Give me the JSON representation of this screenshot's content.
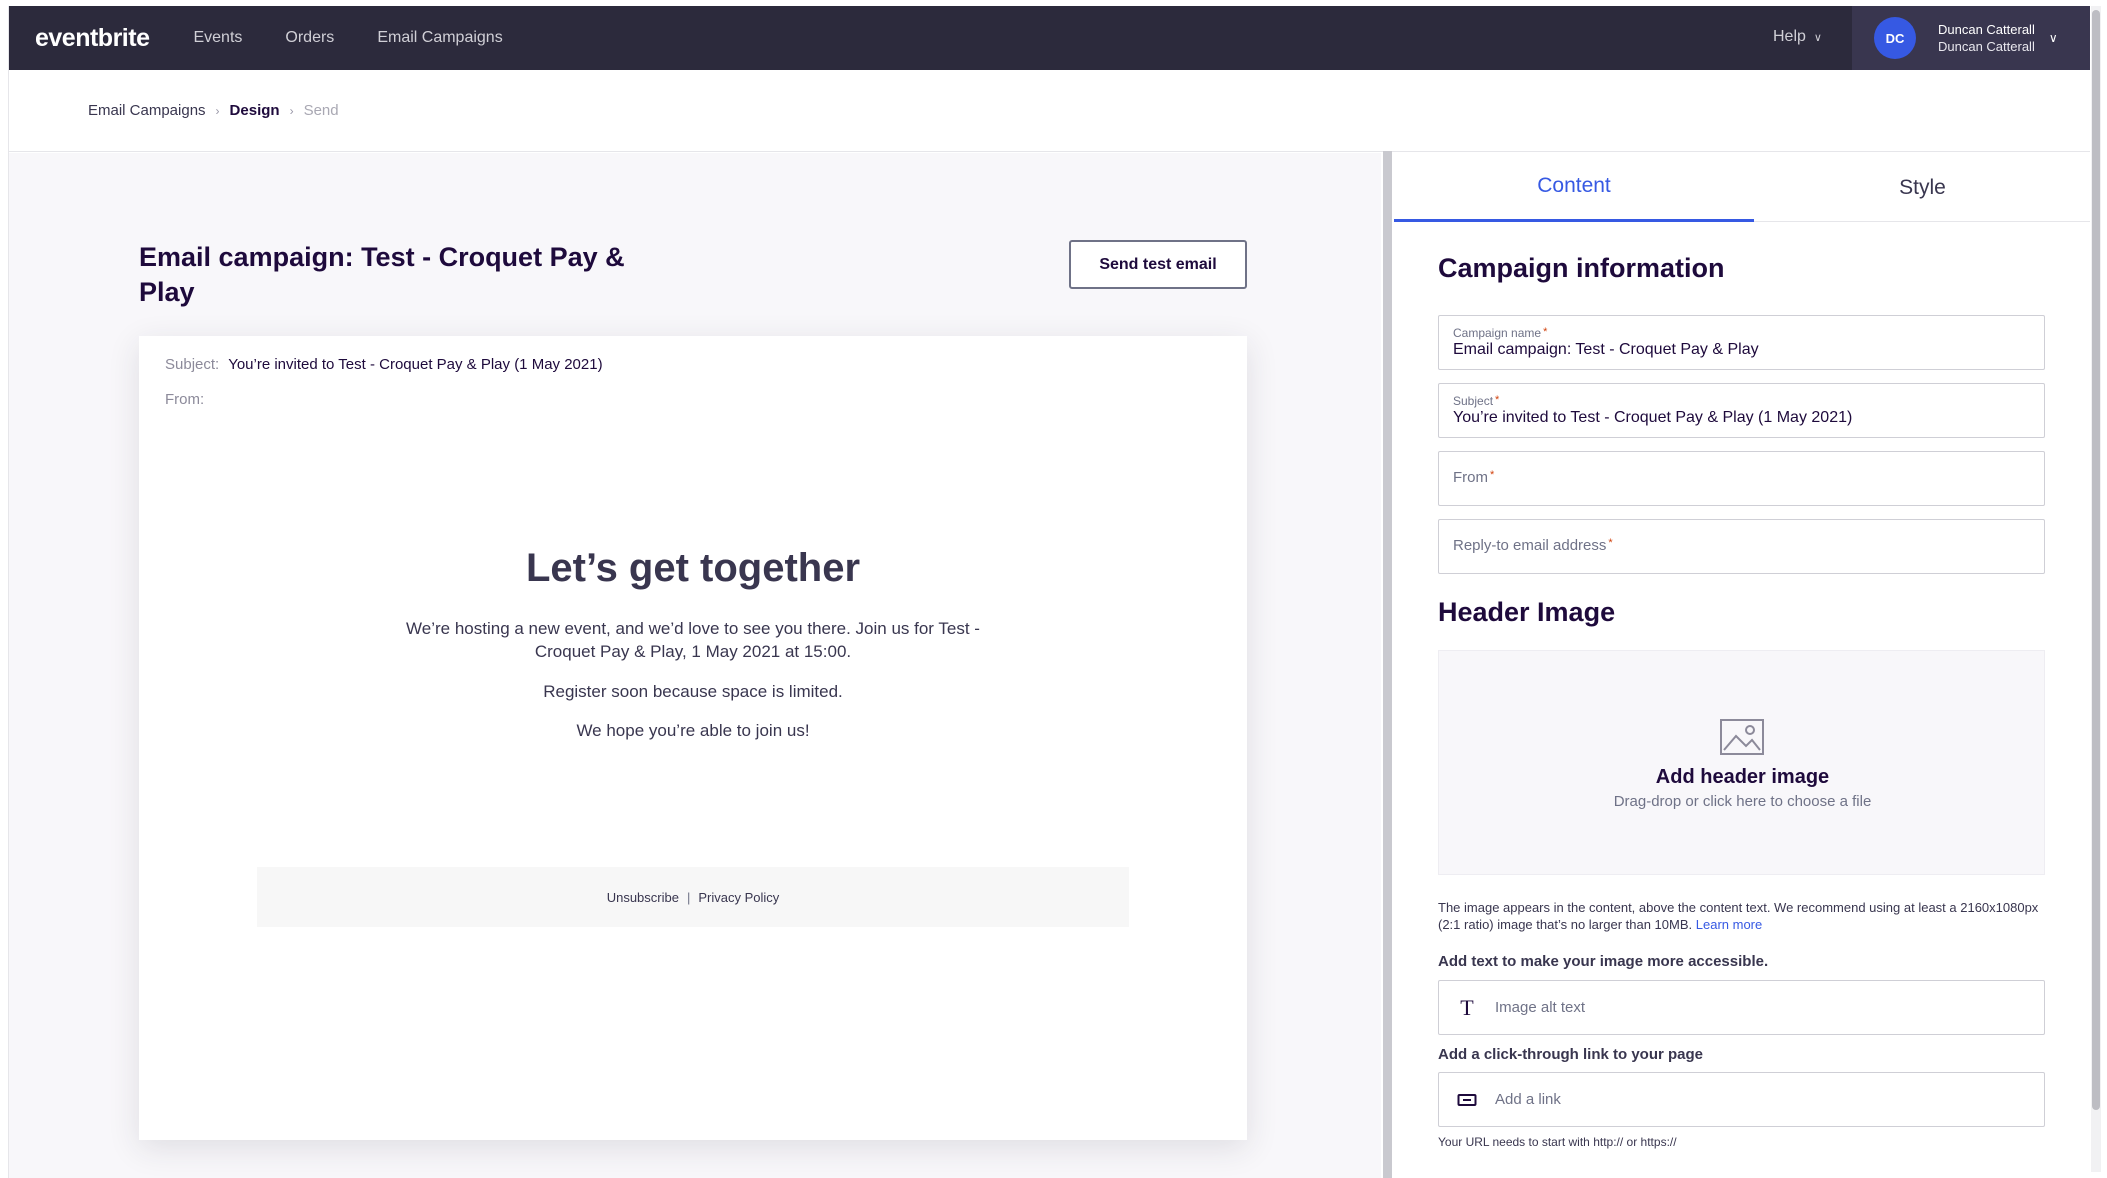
{
  "topbar": {
    "logo": "eventbrite",
    "nav": [
      "Events",
      "Orders",
      "Email Campaigns"
    ],
    "help": "Help",
    "avatar_initials": "DC",
    "user_name": "Duncan Catterall",
    "user_org": "Duncan Catterall"
  },
  "breadcrumb": [
    "Email Campaigns",
    "Design",
    "Send"
  ],
  "editor": {
    "campaign_title": "Email campaign: Test - Croquet Pay & Play",
    "send_test_label": "Send test email"
  },
  "preview": {
    "subject_label": "Subject:",
    "subject_value": "You’re invited to Test - Croquet Pay & Play (1 May 2021)",
    "from_label": "From:",
    "heading": "Let’s get together",
    "body_1": "We’re hosting a new event, and we’d love to see you there. Join us for Test - Croquet Pay & Play, 1 May 2021 at 15:00.",
    "body_2": "Register soon because space is limited.",
    "body_3": "We hope you’re able to join us!",
    "footer_unsubscribe": "Unsubscribe",
    "footer_sep": "|",
    "footer_privacy": "Privacy Policy"
  },
  "panel": {
    "tabs": [
      "Content",
      "Style"
    ],
    "active_tab": "Content",
    "campaign_info_title": "Campaign information",
    "fields": {
      "campaign_name_label": "Campaign name",
      "campaign_name_value": "Email campaign: Test - Croquet Pay & Play",
      "subject_label": "Subject",
      "subject_value": "You’re invited to Test - Croquet Pay & Play (1 May 2021)",
      "from_placeholder": "From",
      "reply_to_placeholder": "Reply-to email address",
      "required_mark": "*"
    },
    "header_image": {
      "title": "Header Image",
      "add_title": "Add header image",
      "add_sub": "Drag-drop or click here to choose a file",
      "helper_text": "The image appears in the content, above the content text. We recommend using at least a 2160x1080px (2:1 ratio) image that’s no larger than 10MB.",
      "learn_more": "Learn more",
      "alt_label": "Add text to make your image more accessible.",
      "alt_placeholder": "Image alt text",
      "link_label": "Add a click-through link to your page",
      "link_placeholder": "Add a link",
      "url_note": "Your URL needs to start with http:// or https://"
    }
  },
  "colors": {
    "topbar": "#2c2a3c",
    "accent": "#3659e3",
    "required": "#d1410c"
  }
}
